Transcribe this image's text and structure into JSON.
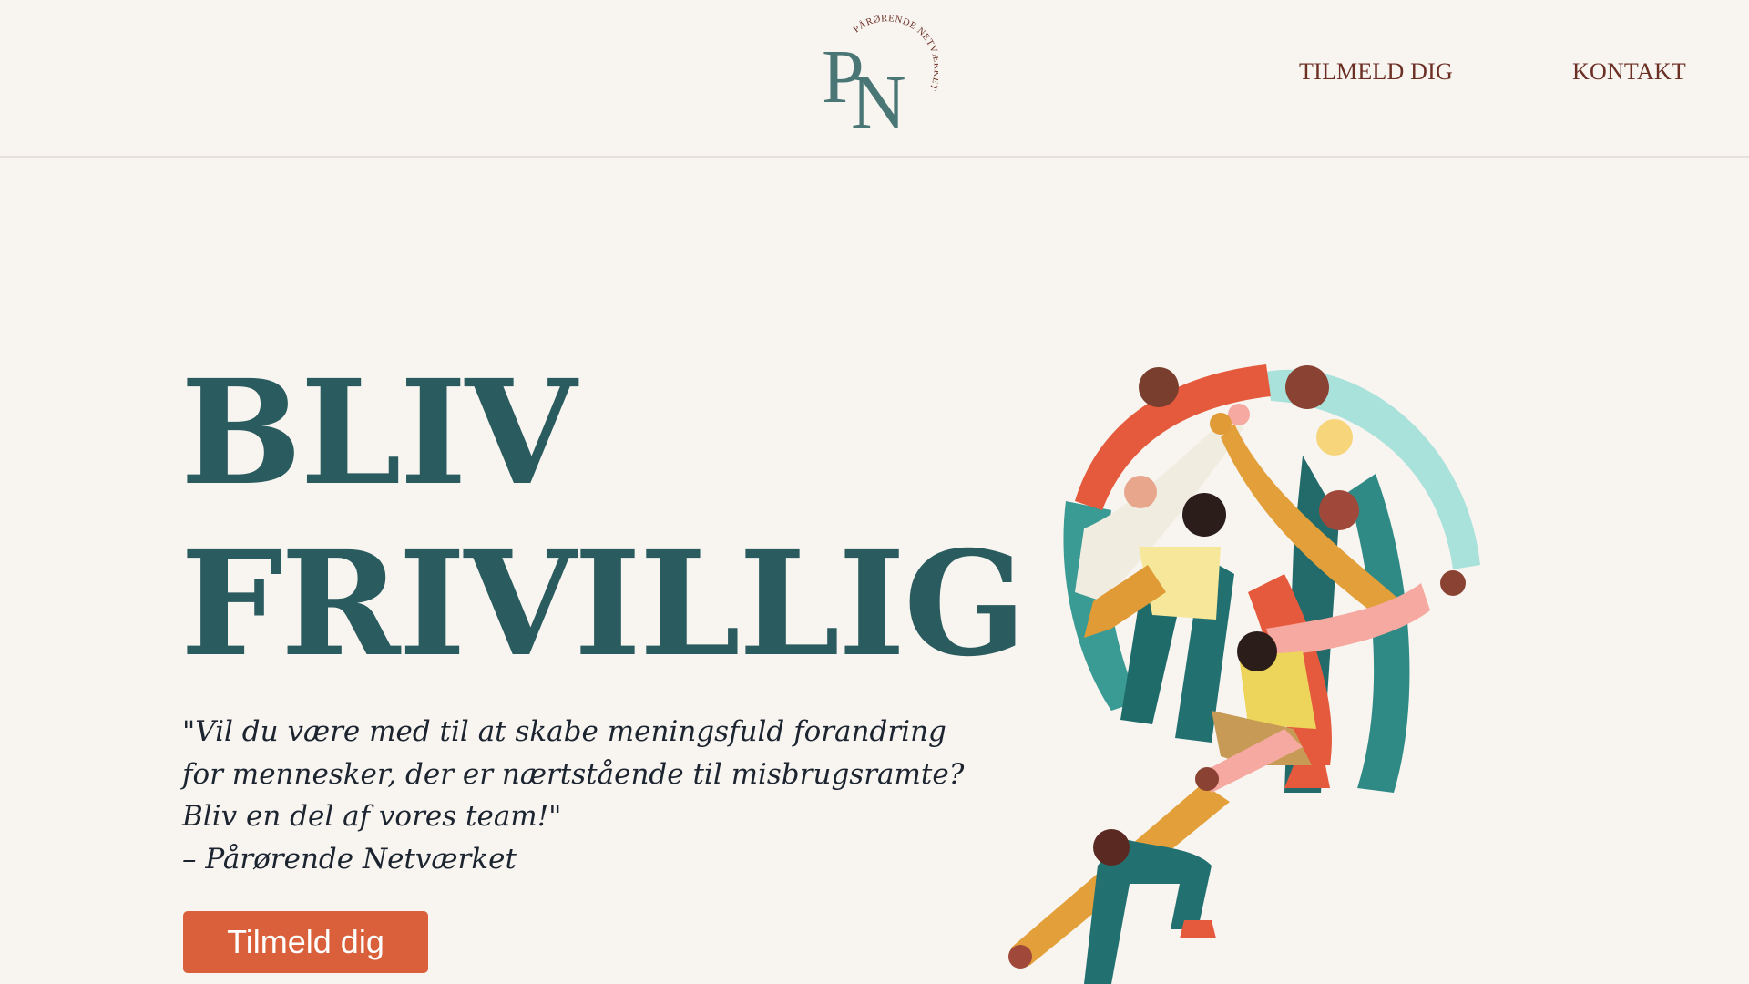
{
  "header": {
    "logo": {
      "letters": "PN",
      "arc_text": "PÅRØRENDE NETVÆRKET",
      "color": "#4a7775"
    },
    "nav": [
      {
        "label": "TILMELD DIG"
      },
      {
        "label": "KONTAKT"
      }
    ]
  },
  "hero": {
    "title_lines": [
      "BLIV",
      "FRIVILLIG"
    ],
    "quote_lines": [
      "\"Vil du være med til at skabe meningsfuld forandring",
      "for mennesker, der er nærtstående til misbrugsramte?",
      "Bliv en del af vores team!\"",
      "– Pårørende Netværket"
    ],
    "cta_label": "Tilmeld dig"
  },
  "colors": {
    "background": "#f8f5f1",
    "title": "#2a5b5e",
    "nav_text": "#6b2f24",
    "cta": "#d9603b"
  }
}
